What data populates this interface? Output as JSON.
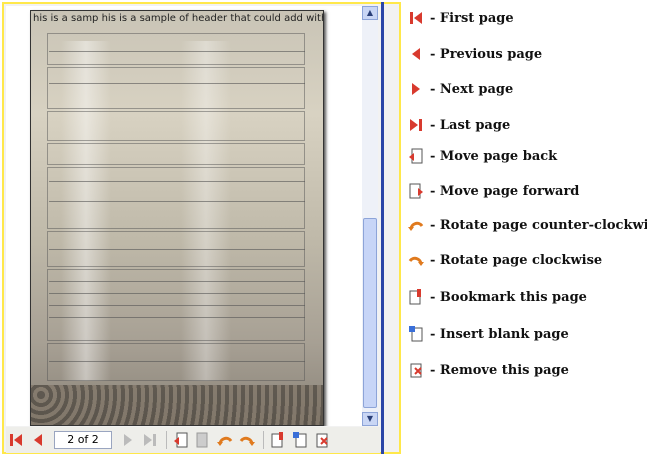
{
  "document": {
    "header_text": "his is a samp his is a sample of header that could add with the..."
  },
  "toolbar": {
    "page_indicator": "2 of 2"
  },
  "legend": [
    {
      "icon": "first-page-icon",
      "label": "- First page"
    },
    {
      "icon": "previous-page-icon",
      "label": "- Previous page"
    },
    {
      "icon": "next-page-icon",
      "label": "- Next page"
    },
    {
      "icon": "last-page-icon",
      "label": "- Last page"
    },
    {
      "icon": "move-page-back-icon",
      "label": "- Move page back"
    },
    {
      "icon": "move-page-forward-icon",
      "label": "- Move page forward"
    },
    {
      "icon": "rotate-ccw-icon",
      "label": "- Rotate page counter-clockwise"
    },
    {
      "icon": "rotate-cw-icon",
      "label": "- Rotate page clockwise"
    },
    {
      "icon": "bookmark-page-icon",
      "label": "- Bookmark this page"
    },
    {
      "icon": "insert-blank-page-icon",
      "label": "- Insert blank page"
    },
    {
      "icon": "remove-page-icon",
      "label": "- Remove this page"
    }
  ],
  "colors": {
    "frame_border": "#ffe84a",
    "separator": "#2b46a8",
    "nav_red": "#d83a2e",
    "rotate_orange": "#e07a1e"
  }
}
